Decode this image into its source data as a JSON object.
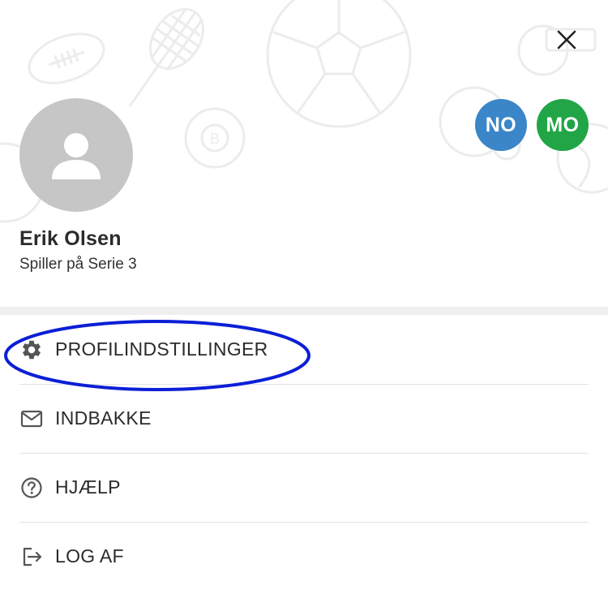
{
  "colors": {
    "chip_primary": "#3a86c8",
    "chip_secondary": "#22a546",
    "avatar_bg": "#c6c6c6",
    "highlight": "#0b1fd6"
  },
  "header": {
    "close_icon": "close-icon",
    "user": {
      "name": "Erik Olsen",
      "role": "Spiller på Serie 3",
      "avatar_icon": "person-icon"
    },
    "chips": [
      {
        "label": "NO"
      },
      {
        "label": "MO"
      }
    ]
  },
  "menu": {
    "items": [
      {
        "label": "PROFILINDSTILLINGER",
        "icon": "gear-icon",
        "highlighted": true
      },
      {
        "label": "INDBAKKE",
        "icon": "mail-icon"
      },
      {
        "label": "HJÆLP",
        "icon": "help-icon"
      },
      {
        "label": "LOG AF",
        "icon": "logout-icon"
      }
    ]
  }
}
